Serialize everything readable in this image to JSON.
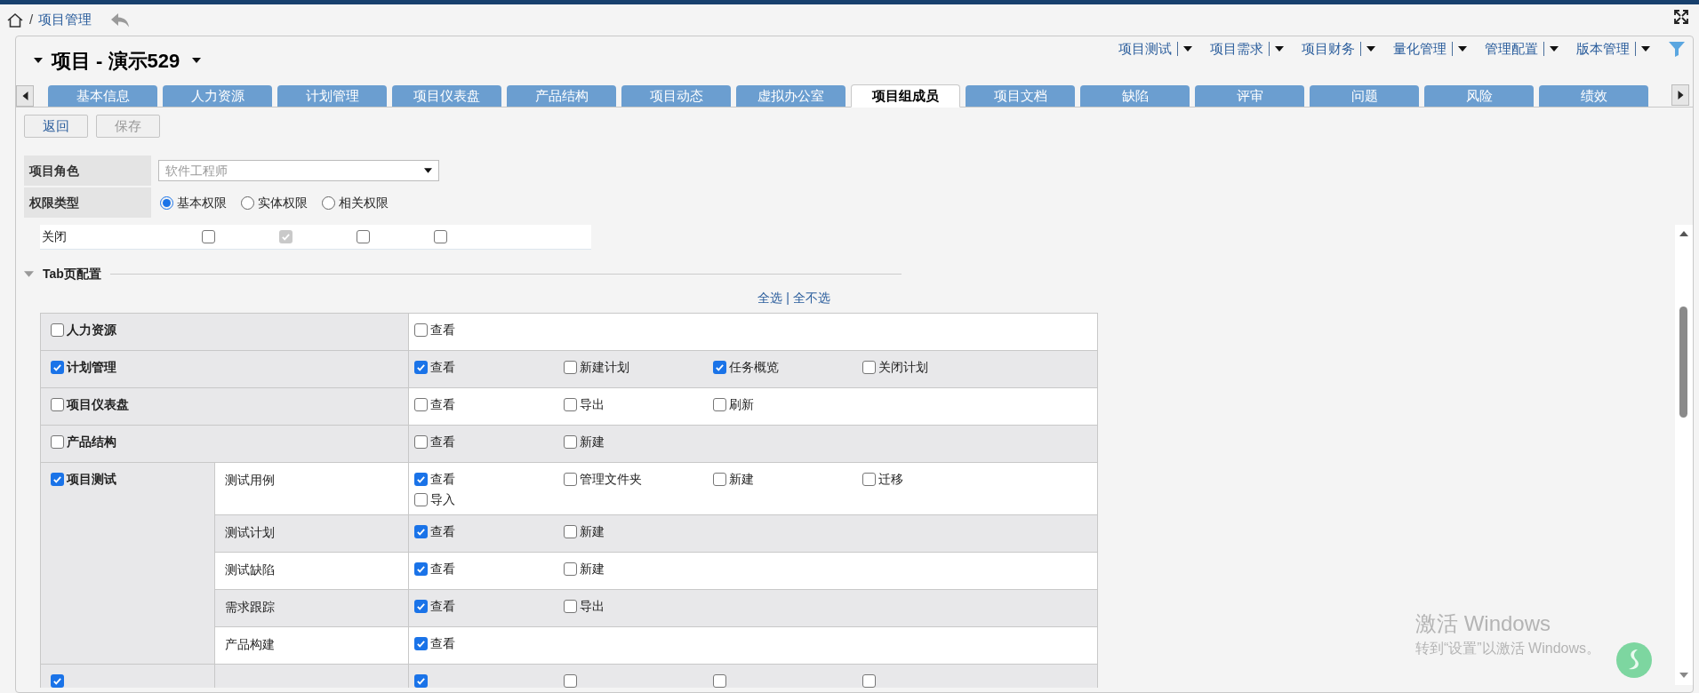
{
  "breadcrumb": {
    "separator": "/",
    "items": [
      "项目管理"
    ]
  },
  "header": {
    "title": "项目 - 演示529",
    "menus": [
      "项目测试",
      "项目需求",
      "项目财务",
      "量化管理",
      "管理配置",
      "版本管理"
    ]
  },
  "tabs": [
    {
      "label": "基本信息",
      "selected": false
    },
    {
      "label": "人力资源",
      "selected": false
    },
    {
      "label": "计划管理",
      "selected": false
    },
    {
      "label": "项目仪表盘",
      "selected": false
    },
    {
      "label": "产品结构",
      "selected": false
    },
    {
      "label": "项目动态",
      "selected": false
    },
    {
      "label": "虚拟办公室",
      "selected": false
    },
    {
      "label": "项目组成员",
      "selected": true
    },
    {
      "label": "项目文档",
      "selected": false
    },
    {
      "label": "缺陷",
      "selected": false
    },
    {
      "label": "评审",
      "selected": false
    },
    {
      "label": "问题",
      "selected": false
    },
    {
      "label": "风险",
      "selected": false
    },
    {
      "label": "绩效",
      "selected": false
    }
  ],
  "buttons": [
    {
      "label": "返回",
      "disabled": false
    },
    {
      "label": "保存",
      "disabled": true
    }
  ],
  "form": {
    "role": {
      "label": "项目角色",
      "value": "软件工程师"
    },
    "permission_type": {
      "label": "权限类型",
      "options": [
        {
          "label": "基本权限",
          "selected": true
        },
        {
          "label": "实体权限",
          "selected": false
        },
        {
          "label": "相关权限",
          "selected": false
        }
      ]
    }
  },
  "close_row": {
    "label": "关闭",
    "checks": [
      {
        "checked": false,
        "disabled": false
      },
      {
        "checked": true,
        "disabled": true
      },
      {
        "checked": false,
        "disabled": false
      },
      {
        "checked": false,
        "disabled": false
      }
    ]
  },
  "tab_config": {
    "title": "Tab页配置",
    "expanded": true,
    "select_all": "全选",
    "separator": "|",
    "select_none": "全不选",
    "rows": [
      {
        "label": "人力资源",
        "checked": false,
        "perms": [
          {
            "label": "查看",
            "checked": false
          }
        ]
      },
      {
        "label": "计划管理",
        "checked": true,
        "perms": [
          {
            "label": "查看",
            "checked": true
          },
          {
            "label": "新建计划",
            "checked": false
          },
          {
            "label": "任务概览",
            "checked": true
          },
          {
            "label": "关闭计划",
            "checked": false
          }
        ]
      },
      {
        "label": "项目仪表盘",
        "checked": false,
        "perms": [
          {
            "label": "查看",
            "checked": false
          },
          {
            "label": "导出",
            "checked": false
          },
          {
            "label": "刷新",
            "checked": false
          }
        ]
      },
      {
        "label": "产品结构",
        "checked": false,
        "perms": [
          {
            "label": "查看",
            "checked": false
          },
          {
            "label": "新建",
            "checked": false
          }
        ]
      },
      {
        "label": "项目测试",
        "checked": true,
        "sub_rows": [
          {
            "label": "测试用例",
            "perms": [
              {
                "label": "查看",
                "checked": true
              },
              {
                "label": "管理文件夹",
                "checked": false
              },
              {
                "label": "新建",
                "checked": false
              },
              {
                "label": "迁移",
                "checked": false
              },
              {
                "label": "导入",
                "checked": false
              }
            ]
          },
          {
            "label": "测试计划",
            "perms": [
              {
                "label": "查看",
                "checked": true
              },
              {
                "label": "新建",
                "checked": false
              }
            ]
          },
          {
            "label": "测试缺陷",
            "perms": [
              {
                "label": "查看",
                "checked": true
              },
              {
                "label": "新建",
                "checked": false
              }
            ]
          },
          {
            "label": "需求跟踪",
            "perms": [
              {
                "label": "查看",
                "checked": true
              },
              {
                "label": "导出",
                "checked": false
              }
            ]
          },
          {
            "label": "产品构建",
            "perms": [
              {
                "label": "查看",
                "checked": true
              }
            ]
          }
        ]
      },
      {
        "checked": true,
        "sub_rows": [
          {
            "perms": [
              {
                "checked": true
              },
              {
                "checked": false
              },
              {
                "checked": false
              },
              {
                "checked": false
              }
            ]
          }
        ]
      }
    ]
  },
  "windows_notice": {
    "title": "激活 Windows",
    "text": "转到“设置”以激活 Windows。"
  }
}
